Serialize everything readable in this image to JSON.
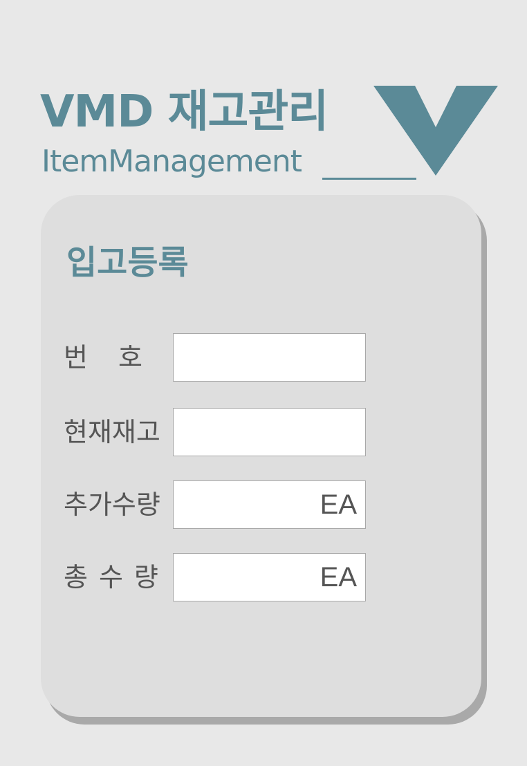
{
  "header": {
    "title": "VMD 재고관리",
    "subtitle": "ItemManagement",
    "logo_icon": "v-logo-icon"
  },
  "form": {
    "title": "입고등록",
    "fields": [
      {
        "label": "번호",
        "value": "",
        "placeholder": ""
      },
      {
        "label": "현재재고",
        "value": "",
        "placeholder": ""
      },
      {
        "label": "추가수량",
        "value": "",
        "placeholder": "",
        "unit": "EA"
      },
      {
        "label": "총수량",
        "value": "",
        "placeholder": "",
        "unit": "EA"
      }
    ]
  },
  "colors": {
    "accent": "#5b8a97",
    "background": "#e8e8e8",
    "card": "#dedede",
    "card_shadow": "#a9a9a9",
    "label_text": "#555555",
    "input_border": "#a8a8a8"
  }
}
